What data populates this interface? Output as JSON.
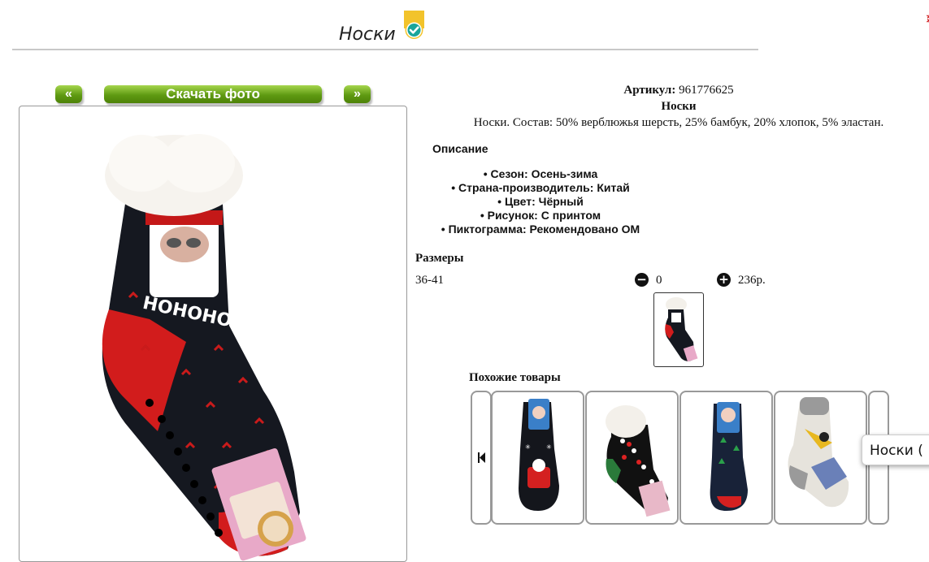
{
  "header": {
    "title": "Носки",
    "badge_icon": "check-badge-icon",
    "badge_colors": {
      "flag": "#f2c32b",
      "circle": "#1aa59a"
    }
  },
  "gallery": {
    "prev_label": "«",
    "download_label": "Скачать фото",
    "next_label": "»",
    "button_color": "#6fa61c"
  },
  "product": {
    "article_label": "Артикул:",
    "article_value": "961776625",
    "name": "Носки",
    "composition": "Носки. Состав: 50% верблюжья шерсть, 25% бамбук, 20% хлопок, 5% эластан."
  },
  "description": {
    "heading": "Описание",
    "properties": [
      "Сезон: Осень-зима",
      "Страна-производитель: Китай",
      "Цвет: Чёрный",
      "Рисунок: С принтом",
      "Пиктограмма: Рекомендовано ОМ"
    ]
  },
  "sizes": {
    "heading": "Размеры",
    "rows": [
      {
        "size": "36-41",
        "quantity": "0",
        "price": "236р."
      }
    ],
    "minus_icon": "minus-circle-icon",
    "plus_icon": "plus-circle-icon"
  },
  "similar": {
    "heading": "Похожие товары",
    "prev_icon": "skip-back-icon",
    "items": [
      "sock-santa-dark",
      "sock-polka-dot",
      "sock-trees-navy",
      "sock-bird-grey"
    ]
  },
  "tooltip": {
    "text": "Носки ("
  }
}
